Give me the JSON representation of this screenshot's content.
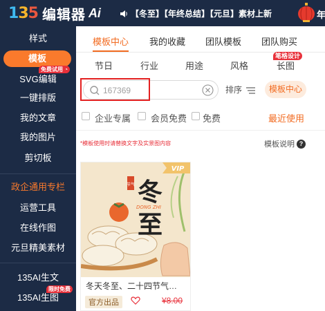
{
  "app": {
    "logo_digits": [
      "1",
      "3",
      "5"
    ],
    "logo_name": "编辑器",
    "logo_ai": "Ai",
    "announcement": "【冬至】【年终总结】【元旦】素材上新",
    "corner_text": "年"
  },
  "sidebar": {
    "items": [
      {
        "label": "样式"
      },
      {
        "label": "模板"
      },
      {
        "label": "SVG编辑"
      },
      {
        "label": "一键排版"
      },
      {
        "label": "我的文章"
      },
      {
        "label": "我的图片"
      },
      {
        "label": "剪切板"
      },
      {
        "label": "政企通用专栏"
      },
      {
        "label": "运营工具"
      },
      {
        "label": "在线作图"
      },
      {
        "label": "元旦精美素材"
      },
      {
        "label": "135AI生文"
      },
      {
        "label": "135AI生图"
      }
    ],
    "badge_free_trial": "免费试用",
    "badge_limited_free": "限时免费"
  },
  "tabs": {
    "items": [
      {
        "label": "模板中心"
      },
      {
        "label": "我的收藏"
      },
      {
        "label": "团队模板"
      },
      {
        "label": "团队购买"
      }
    ]
  },
  "categories": {
    "items": [
      {
        "label": "节日"
      },
      {
        "label": "行业"
      },
      {
        "label": "用途"
      },
      {
        "label": "风格"
      },
      {
        "label": "长图"
      }
    ],
    "badge": "笔格设计"
  },
  "search": {
    "placeholder": "167369",
    "sort_label": "排序",
    "center_button": "模板中心"
  },
  "filters": {
    "enterprise": "企业专属",
    "member_free": "会员免费",
    "free": "免费",
    "recent": "最近使用"
  },
  "notice": "*模板使用时请替换文字及实景图内容",
  "template_help": "模板说明",
  "card": {
    "vip": "VIP",
    "poster_big_char_1": "冬",
    "poster_big_char_2": "至",
    "poster_pinyin": "DONG ZHI",
    "poster_tag": "节气",
    "title": "冬天冬至、二十四节气…",
    "official_tag": "官方出品",
    "price": "¥8.00"
  },
  "colors": {
    "sidebar_bg": "#1c2b45",
    "accent_orange": "#f26b21",
    "badge_red": "#e8303a",
    "highlight_box": "#e32020"
  }
}
